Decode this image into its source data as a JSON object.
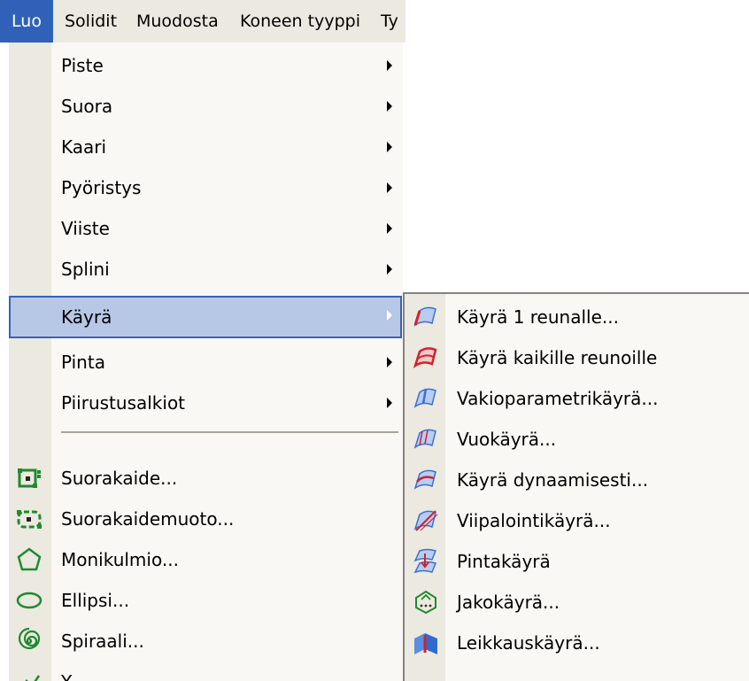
{
  "menubar": {
    "items": [
      {
        "label": "Luo",
        "active": true
      },
      {
        "label": "Solidit"
      },
      {
        "label": "Muodosta"
      },
      {
        "label": "Koneen tyyppi"
      },
      {
        "label": "Ty"
      }
    ]
  },
  "menu": {
    "items": [
      {
        "label": "Piste",
        "submenu": true
      },
      {
        "label": "Suora",
        "submenu": true
      },
      {
        "label": "Kaari",
        "submenu": true
      },
      {
        "label": "Pyöristys",
        "submenu": true
      },
      {
        "label": "Viiste",
        "submenu": true
      },
      {
        "label": "Splini",
        "submenu": true
      },
      {
        "label": "Käyrä",
        "submenu": true,
        "highlighted": true
      },
      {
        "label": "Pinta",
        "submenu": true
      },
      {
        "label": "Piirustusalkiot",
        "submenu": true
      }
    ],
    "items_after_separator": [
      {
        "label": "Suorakaide...",
        "icon": "rectangle-icon"
      },
      {
        "label": "Suorakaidemuoto...",
        "icon": "rectangle-shape-icon"
      },
      {
        "label": "Monikulmio...",
        "icon": "polygon-icon"
      },
      {
        "label": "Ellipsi...",
        "icon": "ellipse-icon"
      },
      {
        "label": "Spiraali...",
        "icon": "spiral-icon"
      },
      {
        "label": "Y...",
        "icon": "partial-icon"
      }
    ]
  },
  "submenu": {
    "items": [
      {
        "label": "Käyrä 1 reunalle...",
        "icon": "curve-one-edge-icon"
      },
      {
        "label": "Käyrä kaikille reunoille",
        "icon": "curve-all-edges-icon"
      },
      {
        "label": "Vakioparametrikäyrä...",
        "icon": "constant-parameter-curve-icon"
      },
      {
        "label": "Vuokäyrä...",
        "icon": "flowline-curve-icon"
      },
      {
        "label": "Käyrä dynaamisesti...",
        "icon": "dynamic-curve-icon"
      },
      {
        "label": "Viipalointikäyrä...",
        "icon": "slice-curve-icon"
      },
      {
        "label": "Pintakäyrä",
        "icon": "surface-curve-icon"
      },
      {
        "label": "Jakokäyrä...",
        "icon": "split-curve-icon"
      },
      {
        "label": "Leikkauskäyrä...",
        "icon": "intersection-curve-icon"
      }
    ]
  },
  "colors": {
    "menubar_bg": "#ebe9e0",
    "active_menu": "#2f61b8",
    "highlight": "#b7c7e6",
    "highlight_border": "#3a62b1",
    "menu_bg": "#f9f8f4",
    "icon_green": "#1f8a2e",
    "icon_blue": "#3c6fd1",
    "icon_red": "#d0222c"
  }
}
